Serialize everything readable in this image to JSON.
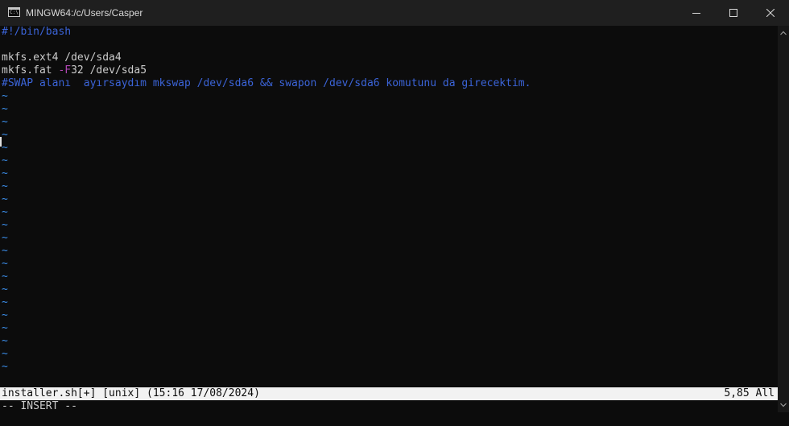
{
  "window": {
    "title": "MINGW64:/c/Users/Casper",
    "app_icon_glyph": "C:\\",
    "icons": [
      "terminal-icon",
      "minimize-icon",
      "maximize-icon",
      "close-icon"
    ]
  },
  "editor": {
    "lines": [
      {
        "type": "comment",
        "text": "#!/bin/bash"
      },
      {
        "type": "empty",
        "text": ""
      },
      {
        "type": "code",
        "segments": [
          {
            "text": "mkfs.ext4 /dev/sda4",
            "style": "normal"
          }
        ]
      },
      {
        "type": "code",
        "segments": [
          {
            "text": "mkfs.fat ",
            "style": "normal"
          },
          {
            "text": "-F",
            "style": "flag"
          },
          {
            "text": "32 /dev/sda5",
            "style": "normal"
          }
        ]
      },
      {
        "type": "comment",
        "text": "#SWAP alanı  ayırsaydım mkswap /dev/sda6 && swapon /dev/sda6 komutunu da girecektim."
      }
    ],
    "empty_line_marker": "~",
    "empty_line_count": 22
  },
  "statusline": {
    "left": "installer.sh[+] [unix] (15:16 17/08/2024)",
    "right": "5,85 All"
  },
  "mode": "-- INSERT --",
  "colors": {
    "background": "#0c0c0c",
    "comment": "#3b64d8",
    "flag": "#b147b5",
    "tilde": "#3b8eea",
    "statusline_bg": "#f2f2f2"
  }
}
